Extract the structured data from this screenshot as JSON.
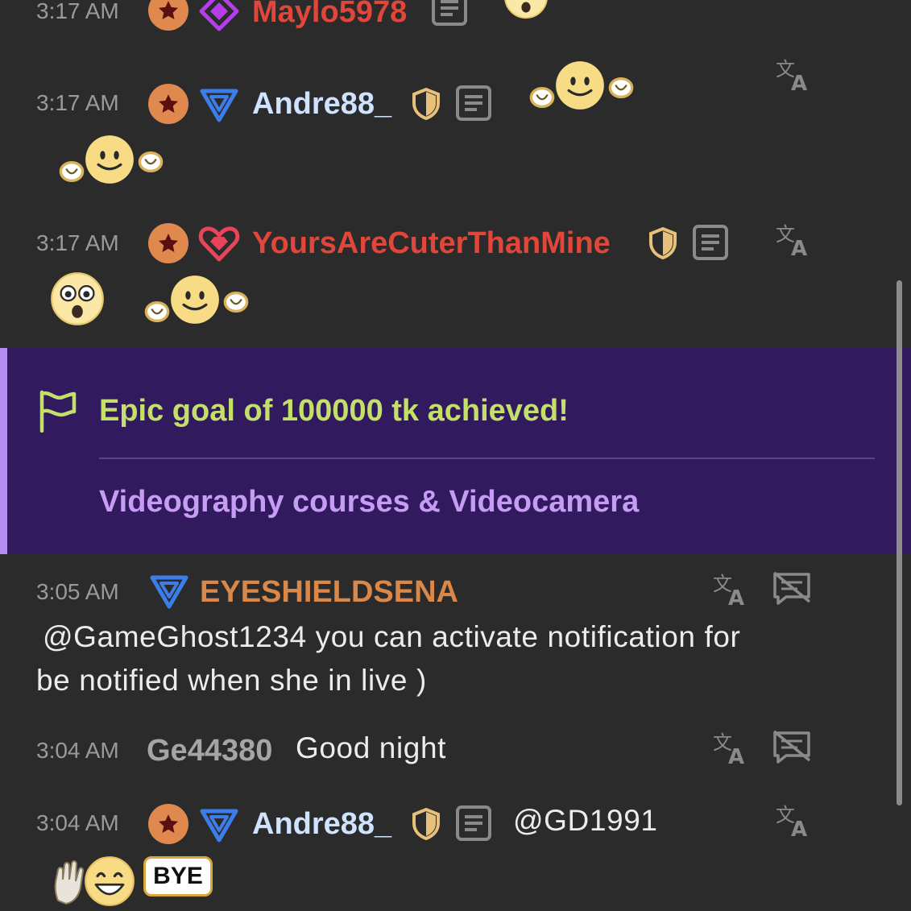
{
  "messages": [
    {
      "time": "3:17 AM",
      "username": "Maylo5978",
      "username_color": "#e0473a"
    },
    {
      "time": "3:17 AM",
      "username": "Andre88_",
      "username_color": "#cfe3ff"
    },
    {
      "time": "3:17 AM",
      "username": "YoursAreCuterThanMine",
      "username_color": "#e0473a"
    },
    {
      "time": "3:05 AM",
      "username": "EYESHIELDSENA",
      "username_color": "#d9884a",
      "text_line1": "@GameGhost1234  you can activate notification for",
      "text_line2": "be notified when she in live )"
    },
    {
      "time": "3:04 AM",
      "username": "Ge44380",
      "username_color": "#a5a5a5",
      "text": "Good night"
    },
    {
      "time": "3:04 AM",
      "username": "Andre88_",
      "username_color": "#cfe3ff",
      "text": "@GD1991",
      "sticker_text": "BYE"
    }
  ],
  "goal": {
    "title": "Epic goal of 100000 tk achieved!",
    "description": "Videography courses & Videocamera",
    "title_color": "#c4e06a",
    "description_color": "#c79cf5"
  },
  "icons": {
    "star_badge": "star-badge-icon",
    "diamond_rank": "diamond-rank-icon",
    "triangle_rank": "triangle-rank-icon",
    "heart_rank": "heart-rank-icon",
    "shield": "shield-icon",
    "notes": "notes-icon",
    "translate": "translate-icon",
    "no_chat": "no-chat-icon"
  }
}
